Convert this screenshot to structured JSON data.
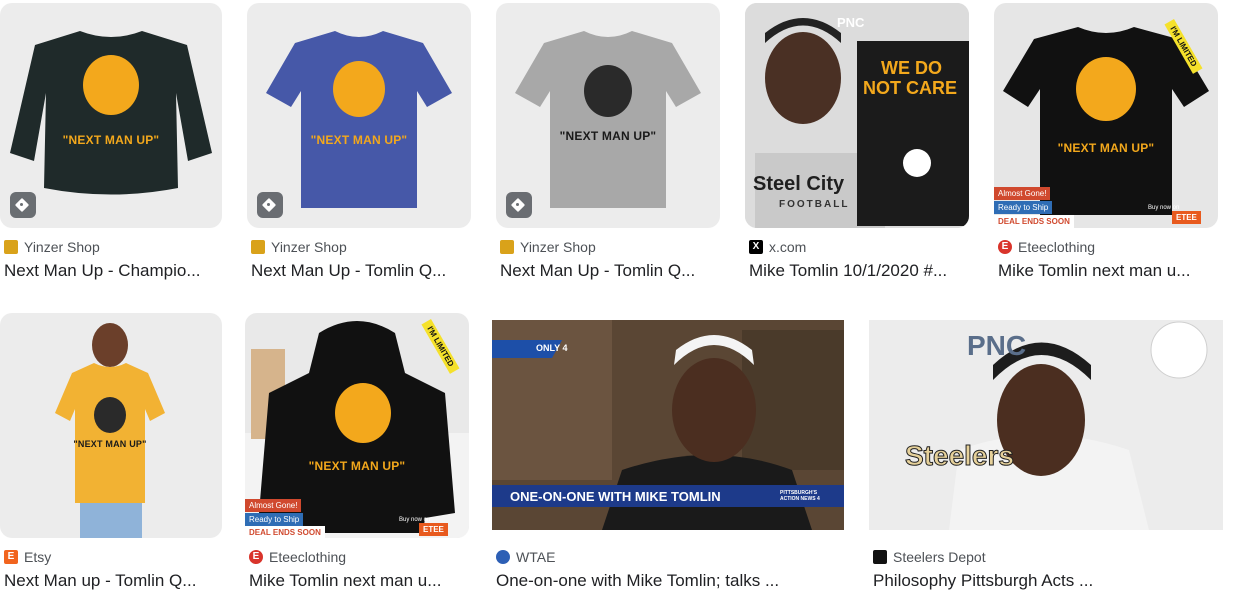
{
  "results": [
    {
      "source": "Yinzer Shop",
      "title": "Next Man Up - Champio...",
      "shirt_text": "\"NEXT MAN UP\""
    },
    {
      "source": "Yinzer Shop",
      "title": "Next Man Up - Tomlin Q...",
      "shirt_text": "\"NEXT MAN UP\""
    },
    {
      "source": "Yinzer Shop",
      "title": "Next Man Up - Tomlin Q...",
      "shirt_text": "\"NEXT MAN UP\""
    },
    {
      "source": "x.com",
      "title": "Mike Tomlin 10/1/2020 #...",
      "quote_line1": "WE DO",
      "quote_line2": "NOT CARE",
      "shirt_line1": "Steel City",
      "shirt_line2": "FOOTBALL",
      "sponsor": "PNC"
    },
    {
      "source": "Eteeclothing",
      "title": "Mike Tomlin next man u...",
      "shirt_text": "\"NEXT MAN UP\"",
      "ribbon": "I'M LIMITED",
      "badge1": "Almost Gone!",
      "badge2": "Ready to Ship",
      "badge3": "DEAL ENDS SOON",
      "buy": "Buy now on",
      "brand": "ETEE"
    },
    {
      "source": "Etsy",
      "title": "Next Man up - Tomlin Q...",
      "shirt_text": "\"NEXT MAN UP\""
    },
    {
      "source": "Eteeclothing",
      "title": "Mike Tomlin next man u...",
      "shirt_text": "\"NEXT MAN UP\"",
      "ribbon": "I'M LIMITED",
      "badge1": "Almost Gone!",
      "badge2": "Ready to Ship",
      "badge3": "DEAL ENDS SOON",
      "buy": "Buy now on",
      "brand": "ETEE"
    },
    {
      "source": "WTAE",
      "title": "One-on-one with Mike Tomlin; talks ...",
      "lower_third": "ONE-ON-ONE WITH MIKE TOMLIN",
      "bug": "ONLY 4",
      "station": "PITTSBURGH'S ACTION NEWS 4"
    },
    {
      "source": "Steelers Depot",
      "title": "Philosophy Pittsburgh Acts ...",
      "backdrop1": "PNC",
      "backdrop2": "Steelers"
    }
  ],
  "colors": {
    "gold": "#f3a81c",
    "navy": "#1c2a4a",
    "steelers_black": "#111111"
  }
}
